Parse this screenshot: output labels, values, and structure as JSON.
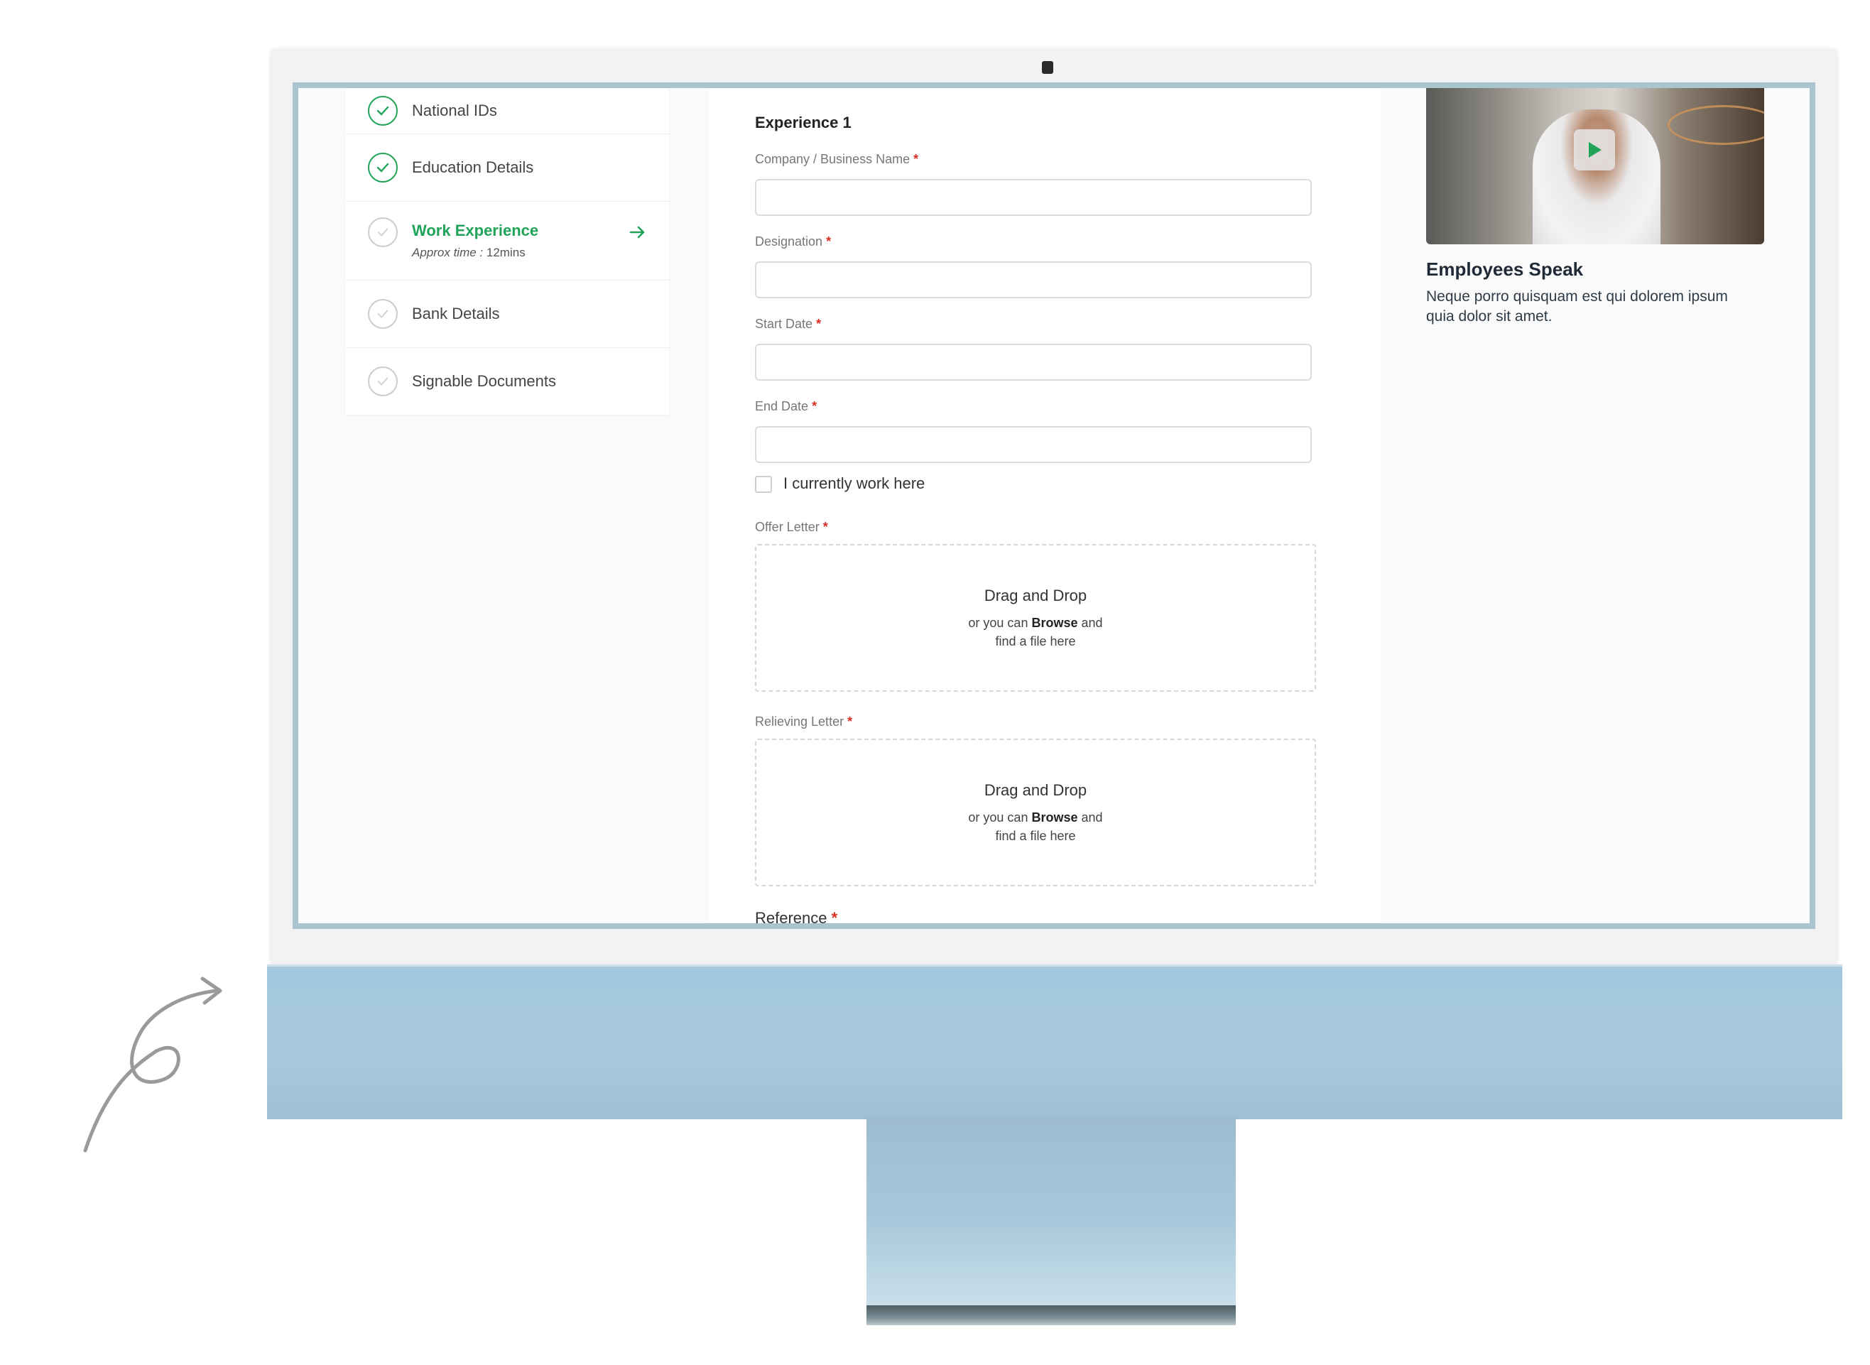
{
  "steps": [
    {
      "label": "National IDs",
      "status": "done",
      "icon": "check-icon"
    },
    {
      "label": "Education Details",
      "status": "done",
      "icon": "check-icon"
    },
    {
      "label": "Work Experience",
      "status": "active",
      "approx_label": "Approx time :",
      "approx_value": "12mins",
      "icon": "check-icon"
    },
    {
      "label": "Bank Details",
      "status": "pending",
      "icon": "check-icon"
    },
    {
      "label": "Signable Documents",
      "status": "pending",
      "icon": "check-icon"
    }
  ],
  "form": {
    "section_title": "Experience 1",
    "required_mark": "*",
    "fields": [
      {
        "label": "Company / Business Name",
        "value": ""
      },
      {
        "label": "Designation",
        "value": ""
      },
      {
        "label": "Start Date",
        "value": ""
      },
      {
        "label": "End Date",
        "value": ""
      }
    ],
    "currently_work_here": {
      "label": "I currently work here",
      "checked": false
    },
    "uploads": [
      {
        "label": "Offer Letter",
        "title": "Drag and Drop",
        "line1_pre": "or you can",
        "line1_bold": "Browse",
        "line1_post": "and",
        "line2": "find a file here"
      },
      {
        "label": "Relieving Letter",
        "title": "Drag and Drop",
        "line1_pre": "or you can",
        "line1_bold": "Browse",
        "line1_post": "and",
        "line2": "find a file here"
      }
    ],
    "reference_label": "Reference"
  },
  "sidebar_right": {
    "title": "Employees Speak",
    "description": "Neque porro quisquam est qui dolorem ipsum quia dolor sit amet.",
    "video_icon": "play-icon"
  },
  "colors": {
    "accent": "#21a35a",
    "required": "#d93025",
    "monitor_body": "#a2c7de",
    "screen_border": "#a9c6cf"
  }
}
